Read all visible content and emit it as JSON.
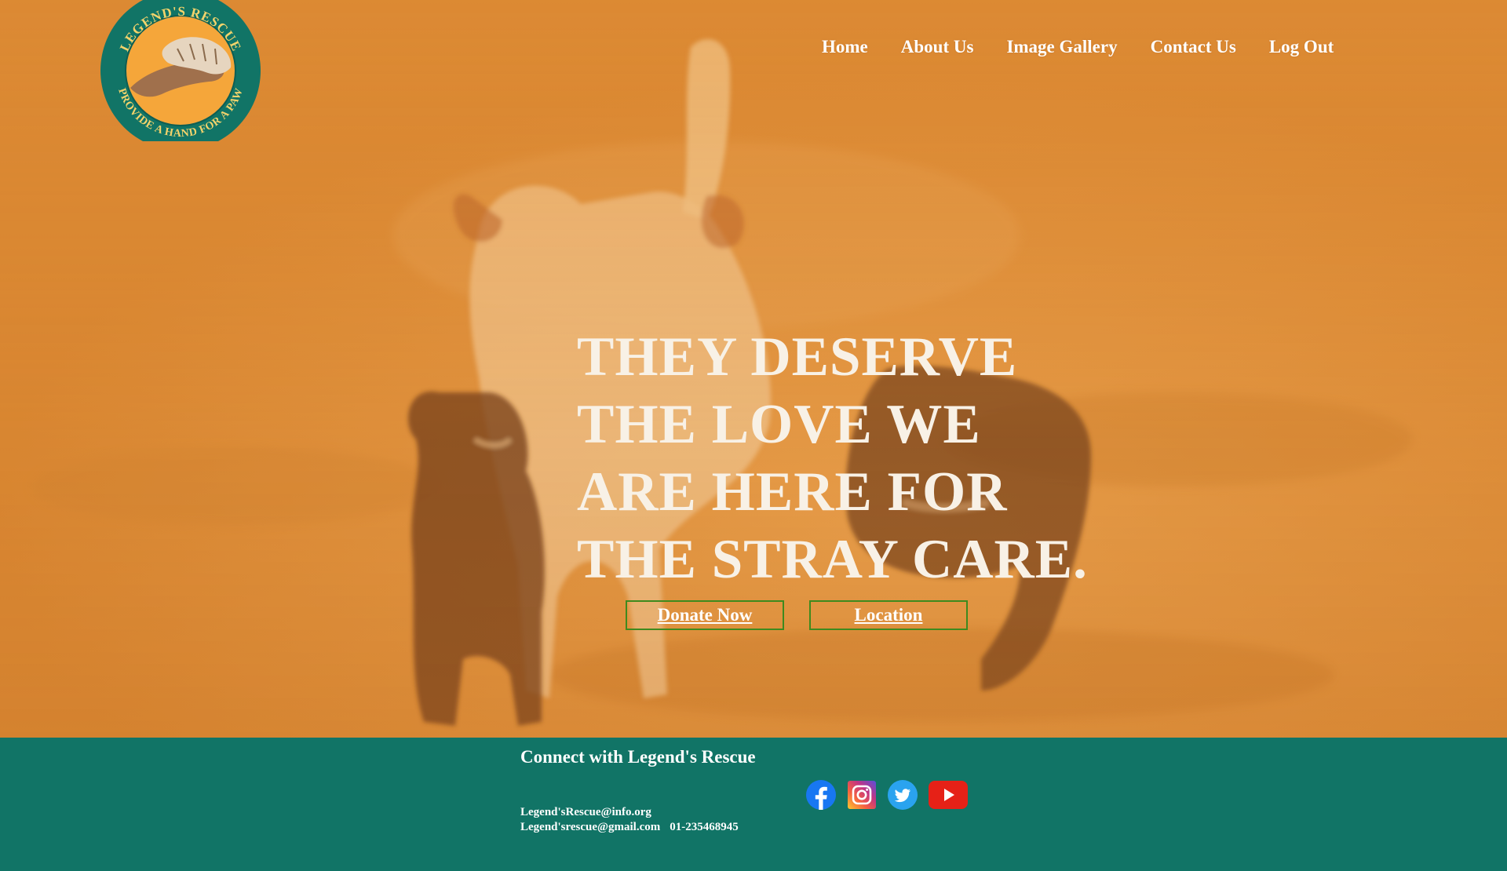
{
  "brand": {
    "logo_ring_text_top": "LEGEND'S RESCUE",
    "logo_ring_text_bottom": "PROVIDE A HAND FOR A PAW",
    "colors": {
      "ring": "#117466",
      "inner": "#f5a63a",
      "ring_text": "#f3d36b"
    }
  },
  "nav": {
    "items": [
      {
        "label": "Home"
      },
      {
        "label": "About Us"
      },
      {
        "label": "Image Gallery"
      },
      {
        "label": "Contact Us"
      },
      {
        "label": "Log Out"
      }
    ]
  },
  "hero": {
    "headline_lines": [
      "THEY DESERVE",
      "THE LOVE WE",
      "ARE HERE FOR",
      "THE STRAY CARE."
    ],
    "buttons": {
      "donate_label": "Donate Now",
      "location_label": "Location"
    },
    "colors": {
      "overlay": "#dd8d36",
      "button_border": "#3e8a1e"
    }
  },
  "footer": {
    "title": "Connect with Legend's Rescue",
    "email_1": "Legend'sRescue@info.org",
    "email_2": "Legend'srescue@gmail.com",
    "phone": "01-235468945",
    "background": "#117466",
    "socials": [
      {
        "icon": "facebook-icon"
      },
      {
        "icon": "instagram-icon"
      },
      {
        "icon": "twitter-icon"
      },
      {
        "icon": "youtube-icon"
      }
    ]
  }
}
